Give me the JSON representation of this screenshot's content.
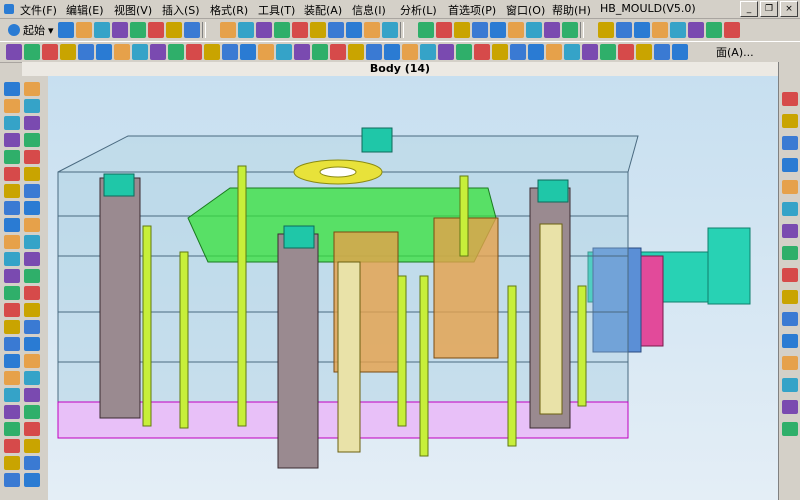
{
  "menu": {
    "items": [
      {
        "label": "文件(F)"
      },
      {
        "label": "编辑(E)"
      },
      {
        "label": "视图(V)"
      },
      {
        "label": "插入(S)"
      },
      {
        "label": "格式(R)"
      },
      {
        "label": "工具(T)"
      },
      {
        "label": "装配(A)"
      },
      {
        "label": "信息(I)"
      },
      {
        "label": "分析(L)"
      },
      {
        "label": "首选项(P)"
      },
      {
        "label": "窗口(O)"
      },
      {
        "label": "帮助(H)"
      },
      {
        "label": "HB_MOULD(V5.0)"
      }
    ]
  },
  "toolbar": {
    "start_label": "起始",
    "face_label": "面(A)..."
  },
  "viewport": {
    "title": "Body (14)",
    "colors": {
      "plate": "#9fc8dc",
      "green_plate": "#35e23a",
      "pink_plate": "#ff5cff",
      "column": "#9a8a90",
      "teal": "#1fc7a8",
      "yellow": "#e8e23a",
      "orange": "#e6a14a",
      "cylinder": "#28d2b4",
      "blue_block": "#5b8fd6",
      "magenta_block": "#e24a9a"
    }
  }
}
